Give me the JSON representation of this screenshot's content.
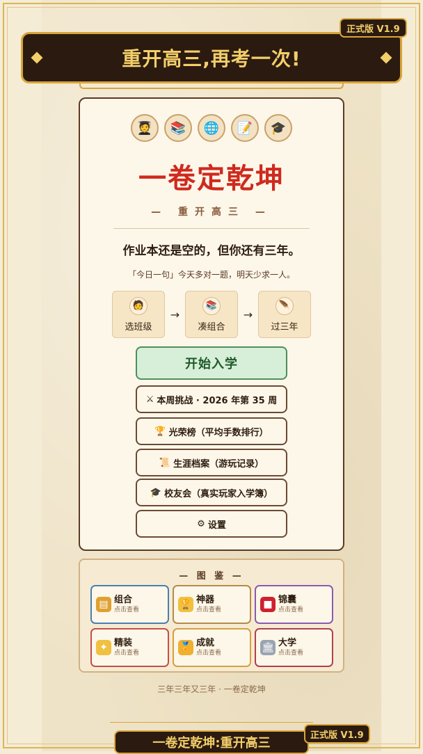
{
  "header": {
    "title": "重开高三,再考一次!",
    "version": "正式版 V1.9"
  },
  "main": {
    "avatars": [
      {
        "icon": "student-icon",
        "glyph": "🧑‍🎓"
      },
      {
        "icon": "books-icon",
        "glyph": "📚"
      },
      {
        "icon": "globe-icon",
        "glyph": "🌐"
      },
      {
        "icon": "paper-icon",
        "glyph": "📝"
      },
      {
        "icon": "graduate-icon",
        "glyph": "🎓"
      }
    ],
    "game_title": "一卷定乾坤",
    "subtitle": "— 重开高三 —",
    "tagline": "作业本还是空的，但你还有三年。",
    "daily_quote": "「今日一句」今天多对一题，明天少求一人。",
    "steps": [
      {
        "label": "选班级",
        "glyph": "🧑"
      },
      {
        "label": "凑组合",
        "glyph": "📚"
      },
      {
        "label": "过三年",
        "glyph": "🪶"
      }
    ],
    "start_button": "开始入学",
    "menu": [
      {
        "icon": "swords-icon",
        "glyph": "⚔",
        "label": "本周挑战 · 2026 年第 35 周"
      },
      {
        "icon": "trophy-icon",
        "glyph": "🏆",
        "label": "光荣榜（平均手数排行）"
      },
      {
        "icon": "scroll-icon",
        "glyph": "📜",
        "label": "生涯档案（游玩记录）"
      },
      {
        "icon": "cap-icon",
        "glyph": "🎓",
        "label": "校友会（真实玩家入学簿）"
      },
      {
        "icon": "gear-icon",
        "glyph": "⚙",
        "label": "设置"
      }
    ]
  },
  "codex": {
    "title": "— 图 鉴 —",
    "items": [
      {
        "name": "组合",
        "hint": "点击查看",
        "icon": "notebook-icon",
        "glyph": "▤",
        "border": "#4a7fb0",
        "icon_bg": "#e0a030"
      },
      {
        "name": "神器",
        "hint": "点击查看",
        "icon": "trophy-icon",
        "glyph": "🏆",
        "border": "#b58a4a",
        "icon_bg": "#f0c040"
      },
      {
        "name": "锦囊",
        "hint": "点击查看",
        "icon": "pouch-icon",
        "glyph": "■",
        "border": "#8a5ab0",
        "icon_bg": "#d02030"
      },
      {
        "name": "精装",
        "hint": "点击查看",
        "icon": "sparkle-icon",
        "glyph": "✦",
        "border": "#c0504a",
        "icon_bg": "#f0c040"
      },
      {
        "name": "成就",
        "hint": "点击查看",
        "icon": "medal-icon",
        "glyph": "🏅",
        "border": "#d4a040",
        "icon_bg": "#f0b030"
      },
      {
        "name": "大学",
        "hint": "点击查看",
        "icon": "university-icon",
        "glyph": "🏛",
        "border": "#b04050",
        "icon_bg": "#9aa4b0"
      }
    ]
  },
  "footer": {
    "slogan": "三年三年又三年 · 一卷定乾坤",
    "banner": "一卷定乾坤:重开高三",
    "version": "正式版 V1.9"
  }
}
